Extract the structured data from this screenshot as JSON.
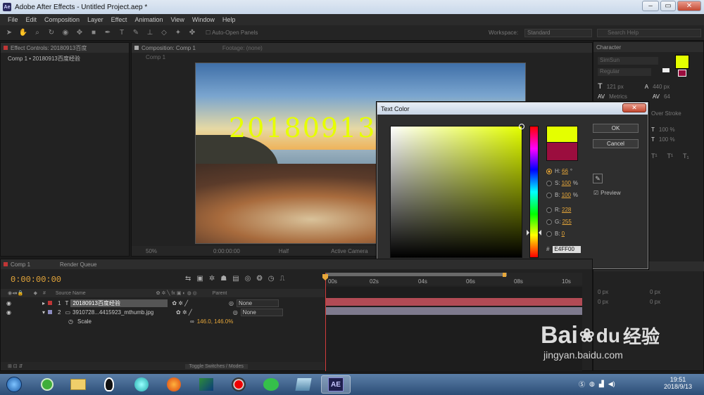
{
  "window": {
    "title": "Adobe After Effects - Untitled Project.aep *",
    "app_icon": "Ae"
  },
  "menu": [
    "File",
    "Edit",
    "Composition",
    "Layer",
    "Effect",
    "Animation",
    "View",
    "Window",
    "Help"
  ],
  "toolbar": {
    "auto_open": "Auto-Open Panels",
    "workspace_label": "Workspace:",
    "workspace_value": "Standard",
    "search_placeholder": "Search Help"
  },
  "effect_controls": {
    "tab": "Effect Controls: 20180913百度",
    "subtitle": "Comp 1 • 20180913百度经验"
  },
  "composition": {
    "tab": "Composition: Comp 1",
    "footage_tab": "Footage: (none)",
    "breadcrumb": "Comp 1",
    "overlay_text": "20180913",
    "zoom": "50%",
    "timecode": "0:00:00:00",
    "resolution": "Half",
    "camera": "Active Camera"
  },
  "character_panel": {
    "tab": "Character",
    "font": "SimSun",
    "style": "Regular",
    "size": "121 px",
    "leading": "440 px",
    "kerning": "Metrics",
    "tracking": "64",
    "stroke_mode": "Over Stroke",
    "scale_h": "100 %",
    "scale_v": "100 %"
  },
  "text_color_dialog": {
    "title": "Text Color",
    "ok": "OK",
    "cancel": "Cancel",
    "h_label": "H:",
    "h_value": "66",
    "h_unit": "°",
    "s_label": "S:",
    "s_value": "100",
    "s_unit": "%",
    "b_label": "B:",
    "b_value": "100",
    "b_unit": "%",
    "r_label": "R:",
    "r_value": "228",
    "g_label": "G:",
    "g_value": "255",
    "b2_label": "B:",
    "b2_value": "0",
    "hex_label": "#",
    "hex_value": "E4FF00",
    "preview": "Preview",
    "new_color": "#e4ff00",
    "old_color": "#9b0d3e"
  },
  "timeline": {
    "tab": "Comp 1",
    "render_tab": "Render Queue",
    "timecode": "0:00:00:00",
    "col_source": "Source Name",
    "col_parent": "Parent",
    "ruler": [
      "00s",
      "02s",
      "04s",
      "06s",
      "08s",
      "10s"
    ],
    "layers": [
      {
        "num": "1",
        "name": "20180913百度经验",
        "parent": "None",
        "color": "#c03636"
      },
      {
        "num": "2",
        "name": "3910728...4415923_mthumb.jpg",
        "parent": "None",
        "color": "#8c8cc0"
      }
    ],
    "scale_label": "Scale",
    "scale_value": "146.0, 146.0%",
    "toggle_label": "Toggle Switches / Modes"
  },
  "right_bottom": {
    "val1": "0 px",
    "val2": "0 px",
    "val3": "0 px",
    "val4": "0 px"
  },
  "watermark": {
    "brand": "Bai",
    "cn": "经验",
    "url": "jingyan.baidu.com"
  },
  "taskbar": {
    "time": "19:51",
    "date": "2018/9/13",
    "ae_label": "AE"
  }
}
